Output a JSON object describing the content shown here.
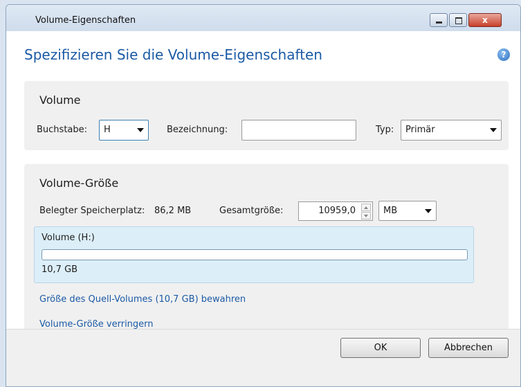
{
  "window": {
    "title": "Volume-Eigenschaften",
    "minimize": "",
    "maximize": "",
    "close": "x"
  },
  "heading": "Spezifizieren Sie die Volume-Eigenschaften",
  "help_icon_glyph": "?",
  "volume_group": {
    "title": "Volume",
    "letter_label": "Buchstabe:",
    "letter_value": "H",
    "name_label": "Bezeichnung:",
    "name_value": "",
    "type_label": "Typ:",
    "type_value": "Primär"
  },
  "size_group": {
    "title": "Volume-Größe",
    "used_label": "Belegter Speicherplatz:",
    "used_value": "86,2 MB",
    "total_label": "Gesamtgröße:",
    "total_value": "10959,0",
    "unit_value": "MB",
    "volume_label": "Volume (H:)",
    "volume_size": "10,7 GB",
    "link_keep": "Größe des Quell-Volumes (10,7 GB) bewahren",
    "link_reduce": "Volume-Größe verringern"
  },
  "buttons": {
    "ok": "OK",
    "cancel": "Abbrechen"
  },
  "colors": {
    "accent": "#1b5aa5",
    "titlebar": "#dfe9f5",
    "close_red": "#c7402b"
  }
}
